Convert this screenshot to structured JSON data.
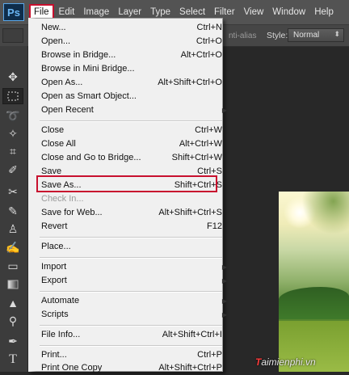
{
  "app": {
    "logo": "Ps"
  },
  "menubar": {
    "items": [
      "File",
      "Edit",
      "Image",
      "Layer",
      "Type",
      "Select",
      "Filter",
      "View",
      "Window",
      "Help"
    ],
    "active": "File"
  },
  "options_bar": {
    "antialias_label": "nti-alias",
    "style_label": "Style:",
    "style_value": "Normal"
  },
  "file_menu": {
    "items": [
      {
        "label": "New...",
        "shortcut": "Ctrl+N"
      },
      {
        "label": "Open...",
        "shortcut": "Ctrl+O"
      },
      {
        "label": "Browse in Bridge...",
        "shortcut": "Alt+Ctrl+O"
      },
      {
        "label": "Browse in Mini Bridge...",
        "shortcut": ""
      },
      {
        "label": "Open As...",
        "shortcut": "Alt+Shift+Ctrl+O"
      },
      {
        "label": "Open as Smart Object...",
        "shortcut": ""
      },
      {
        "label": "Open Recent",
        "shortcut": ""
      },
      {
        "label": "Close",
        "shortcut": "Ctrl+W"
      },
      {
        "label": "Close All",
        "shortcut": "Alt+Ctrl+W"
      },
      {
        "label": "Close and Go to Bridge...",
        "shortcut": "Shift+Ctrl+W"
      },
      {
        "label": "Save",
        "shortcut": "Ctrl+S"
      },
      {
        "label": "Save As...",
        "shortcut": "Shift+Ctrl+S"
      },
      {
        "label": "Check In...",
        "shortcut": ""
      },
      {
        "label": "Save for Web...",
        "shortcut": "Alt+Shift+Ctrl+S"
      },
      {
        "label": "Revert",
        "shortcut": "F12"
      },
      {
        "label": "Place...",
        "shortcut": ""
      },
      {
        "label": "Import",
        "shortcut": ""
      },
      {
        "label": "Export",
        "shortcut": ""
      },
      {
        "label": "Automate",
        "shortcut": ""
      },
      {
        "label": "Scripts",
        "shortcut": ""
      },
      {
        "label": "File Info...",
        "shortcut": "Alt+Shift+Ctrl+I"
      },
      {
        "label": "Print...",
        "shortcut": "Ctrl+P"
      },
      {
        "label": "Print One Copy",
        "shortcut": "Alt+Shift+Ctrl+P"
      }
    ],
    "highlighted": "Save As...",
    "disabled": "Check In..."
  },
  "watermark": {
    "prefix": "T",
    "rest": "aimienphi.vn"
  },
  "colors": {
    "highlight": "#c8102e",
    "menubar": "#535353",
    "menu_bg": "#f0f0f0"
  },
  "toolbox": {
    "icons": [
      "move-icon",
      "marquee-icon",
      "lasso-icon",
      "magic-wand-icon",
      "crop-icon",
      "eyedropper-icon",
      "healing-brush-icon",
      "brush-icon",
      "clone-stamp-icon",
      "history-brush-icon",
      "eraser-icon",
      "gradient-icon",
      "blur-icon",
      "dodge-icon",
      "pen-icon",
      "type-icon"
    ]
  }
}
